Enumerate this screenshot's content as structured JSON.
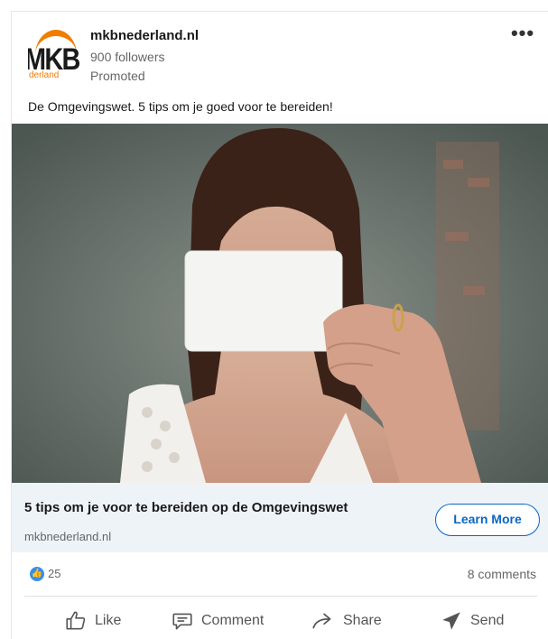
{
  "post": {
    "company": "mkbnederland.nl",
    "followers": "900 followers",
    "promoted": "Promoted",
    "more_label": "•••",
    "text": "De Omgevingswet. 5 tips om je goed voor te bereiden!"
  },
  "logo": {
    "letters": "MKB",
    "sub": "derland"
  },
  "link": {
    "title": "5 tips om je voor te bereiden op de Omgevingswet",
    "domain": "mkbnederland.nl",
    "cta": "Learn More"
  },
  "social": {
    "reactions": "25",
    "comments": "8 comments"
  },
  "actions": {
    "like": "Like",
    "comment": "Comment",
    "share": "Share",
    "send": "Send"
  },
  "colors": {
    "brand_orange": "#f07d00",
    "link_blue": "#0a66c2",
    "strip_bg": "#eef3f8"
  }
}
